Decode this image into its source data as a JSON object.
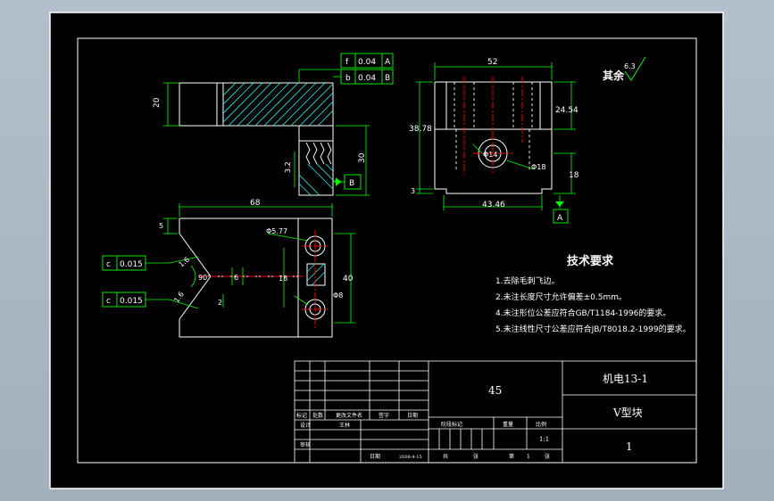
{
  "colors": {
    "page_bg": "#aab5c3",
    "sheet_bg": "#000000",
    "frame": "#ffffff",
    "geometry": "#ffffff",
    "dimension": "#00ff00",
    "centerline": "#ff0000",
    "hatch": "#00ffff",
    "hidden": "#ffff00"
  },
  "dimensions": {
    "top_width": "52",
    "front_height": "38.78",
    "right_height": "24.54",
    "right_small": "18",
    "bottom_width": "43.46",
    "bottom_left": "3",
    "left_height": "20",
    "left_lower": "30",
    "left_small": "3.2",
    "plan_width": "68",
    "plan_left_small": "5",
    "plan_height": "40",
    "plan_inner": "18",
    "plan_offset": "6",
    "plan_small2": "2",
    "hole_dia_top": "Φ5.77",
    "hole_dia_bottom": "Φ8",
    "hole_dia_front": "Φ14",
    "hole_dia_front2": "Φ18",
    "v_angle": "90°",
    "chamfer1": "1.6",
    "chamfer2": "1.6"
  },
  "tolerances": {
    "tol1_symbol": "f",
    "tol1_value": "0.04",
    "tol1_ref": "A",
    "tol2_symbol": "b",
    "tol2_value": "0.04",
    "tol2_ref": "B",
    "tol3_symbol": "c",
    "tol3_value": "0.015",
    "tol4_symbol": "c",
    "tol4_value": "0.015"
  },
  "datums": {
    "datum_a": "A",
    "datum_b": "B"
  },
  "roughness": {
    "label": "其余",
    "value": "6.3"
  },
  "requirements": {
    "title": "技术要求",
    "items": [
      "1.去除毛刺飞边。",
      "2.未注长度尺寸允许偏差±0.5mm。",
      "4.未注形位公差应符合GB/T1184-1996的要求。",
      "5.未注线性尺寸公差应符合JB/T8018.2-1999的要求。"
    ]
  },
  "title_block": {
    "material": "45",
    "drawing_no": "机电13-1",
    "part_name": "V型块",
    "sheet_no": "1",
    "scale": "1:1",
    "rev_headers": [
      "标记",
      "处数",
      "更改文件名",
      "签字",
      "日期"
    ],
    "sign_headers": [
      "设计",
      "审核"
    ],
    "designer": "王林",
    "stage_headers": [
      "阶段标记",
      "重量",
      "比例"
    ],
    "date_label": "日期",
    "date": "2008-4-15",
    "total_label": "共",
    "sheet_label": "张",
    "page_label": "第",
    "page_no": "1",
    "page_unit": "张"
  }
}
